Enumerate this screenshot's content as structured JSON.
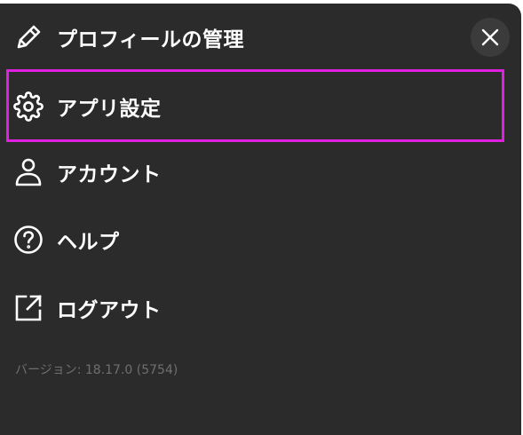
{
  "menu": {
    "items": [
      {
        "label": "プロフィールの管理",
        "icon": "pencil-icon"
      },
      {
        "label": "アプリ設定",
        "icon": "gear-icon"
      },
      {
        "label": "アカウント",
        "icon": "person-icon"
      },
      {
        "label": "ヘルプ",
        "icon": "help-circle-icon"
      },
      {
        "label": "ログアウト",
        "icon": "external-link-icon"
      }
    ],
    "highlighted_index": 1,
    "close_icon": "close-icon"
  },
  "footer": {
    "version": "バージョン: 18.17.0 (5754)"
  },
  "colors": {
    "background": "#2b2b2b",
    "text": "#ffffff",
    "muted_text": "#6f6f6f",
    "highlight": "#e020e0",
    "close_button_bg": "#3b3b3b"
  }
}
